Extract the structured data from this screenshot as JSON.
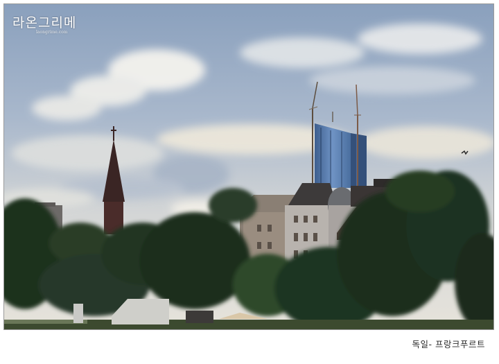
{
  "photo": {
    "subject": "Frankfurt skyline with church spire, old buildings and high-rise towers under construction behind trees",
    "sky_colors": [
      "#7f97b6",
      "#c6d1de",
      "#e8e6e0"
    ],
    "foliage_color": "#1f3320"
  },
  "watermark": {
    "text": "라온그리메",
    "subtext": "laongrime.com"
  },
  "caption": {
    "text": "독일-  프랑크푸르트"
  }
}
